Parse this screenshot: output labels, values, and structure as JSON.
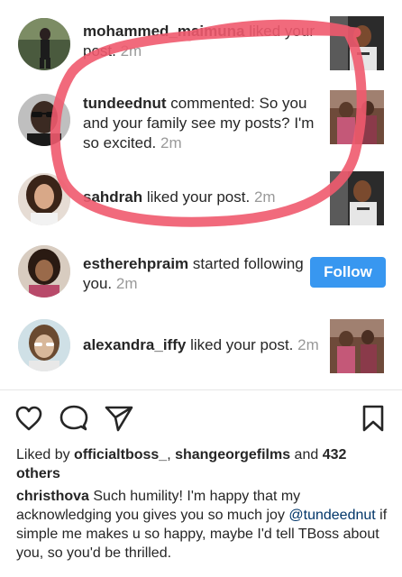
{
  "notifications": [
    {
      "user": "mohammed_maimuna",
      "text": " liked your post.",
      "time": "2m",
      "action": "thumbnail"
    },
    {
      "user": "tundeednut",
      "text": " commented: So you and your family see my posts? I'm so excited.",
      "time": "2m",
      "action": "thumbnail"
    },
    {
      "user": "sahdrah",
      "text": " liked your post.",
      "time": "2m",
      "action": "thumbnail"
    },
    {
      "user": "estherehpraim",
      "text": " started following you.",
      "time": "2m",
      "action": "follow"
    },
    {
      "user": "alexandra_iffy",
      "text": " liked your post.",
      "time": "2m",
      "action": "thumbnail"
    }
  ],
  "follow_label": "Follow",
  "actions": {
    "like": "heart-icon",
    "comment": "comment-icon",
    "share": "send-icon",
    "save": "bookmark-icon"
  },
  "likes": {
    "prefix": "Liked by ",
    "user1": "officialtboss_",
    "sep": ", ",
    "user2": "shangeorgefilms",
    "and": " and ",
    "count": "432 others"
  },
  "caption": {
    "user": "christhova",
    "text1": " Such humility!  I'm happy that my acknowledging you gives you so much joy ",
    "mention": "@tundeednut",
    "text2": " if simple me makes u so happy, maybe I'd tell TBoss about you, so you'd be thrilled."
  },
  "colors": {
    "follow_button": "#3897f0",
    "annotation_circle": "#f05a6e",
    "timestamp": "#999999",
    "mention": "#003569"
  }
}
